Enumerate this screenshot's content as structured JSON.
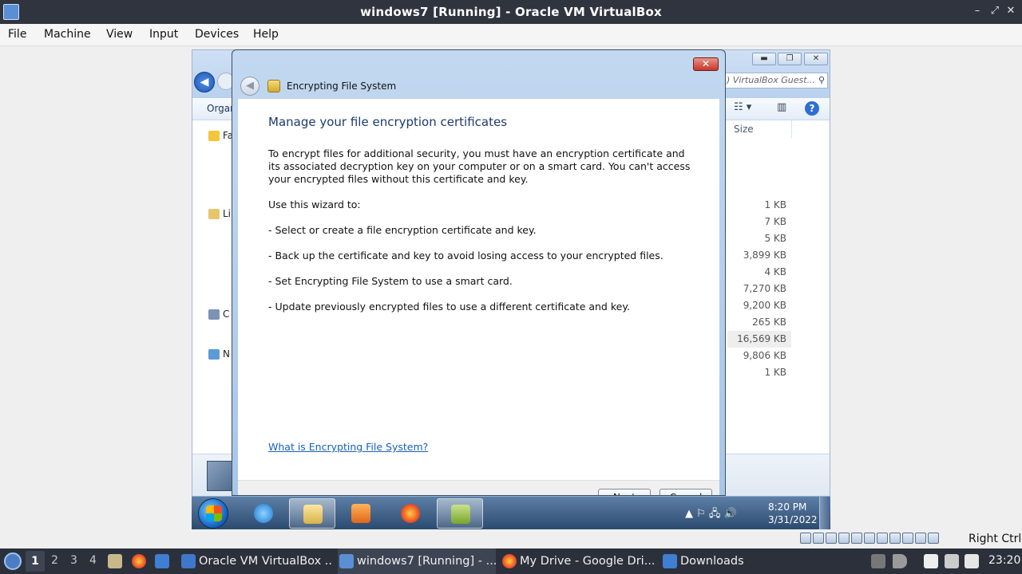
{
  "host": {
    "title": "windows7 [Running] - Oracle VM VirtualBox",
    "menu": [
      "File",
      "Machine",
      "View",
      "Input",
      "Devices",
      "Help"
    ],
    "window_controls": [
      "–",
      "⤢",
      "✕"
    ]
  },
  "explorer": {
    "search_placeholder": ") VirtualBox Guest...",
    "organize_label": "Organ",
    "nav_items": [
      "Fa",
      "Li",
      "C",
      "N"
    ],
    "size_header": "Size",
    "sizes": [
      "1 KB",
      "7 KB",
      "5 KB",
      "3,899 KB",
      "4 KB",
      "7,270 KB",
      "9,200 KB",
      "265 KB",
      "16,569 KB",
      "9,806 KB",
      "1 KB"
    ],
    "highlighted_row_index": 8
  },
  "dialog": {
    "window_title": "Encrypting File System",
    "close_glyph": "✕",
    "heading": "Manage your file encryption certificates",
    "intro": "To encrypt files for additional security, you must have an encryption certificate and its associated decryption key on your computer or on a smart card. You can't access your encrypted files without this certificate and key.",
    "wizard_intro": "Use this wizard to:",
    "bullets": [
      "- Select or create a file encryption certificate and key.",
      "- Back up the certificate and key to avoid losing access to your encrypted files.",
      "- Set Encrypting File System to use a smart card.",
      "- Update previously encrypted files to use a different certificate and key."
    ],
    "help_link": "What is Encrypting File System?",
    "buttons": {
      "next": "Next",
      "cancel": "Cancel"
    }
  },
  "guest_taskbar": {
    "time": "8:20 PM",
    "date": "3/31/2022",
    "tray_glyphs": "▲  ⚐  🖧  🔊"
  },
  "vbox_status": {
    "host_key": "Right Ctrl"
  },
  "host_panel": {
    "workspaces": [
      "1",
      "2",
      "3",
      "4"
    ],
    "current_workspace": "1",
    "tasks": [
      {
        "label": "Oracle VM VirtualBox ...",
        "icon": "virtualbox-icon",
        "active": false
      },
      {
        "label": "windows7 [Running] - ...",
        "icon": "virtualbox-vm-icon",
        "active": true
      },
      {
        "label": "My Drive - Google Dri...",
        "icon": "firefox-icon",
        "active": false
      },
      {
        "label": "Downloads",
        "icon": "folder-icon",
        "active": false
      }
    ],
    "clock": "23:20"
  },
  "colors": {
    "link": "#1660b8",
    "heading": "#1e3a6e",
    "host_bar": "#2f343f",
    "win_taskbar": "#2b4a6f"
  }
}
